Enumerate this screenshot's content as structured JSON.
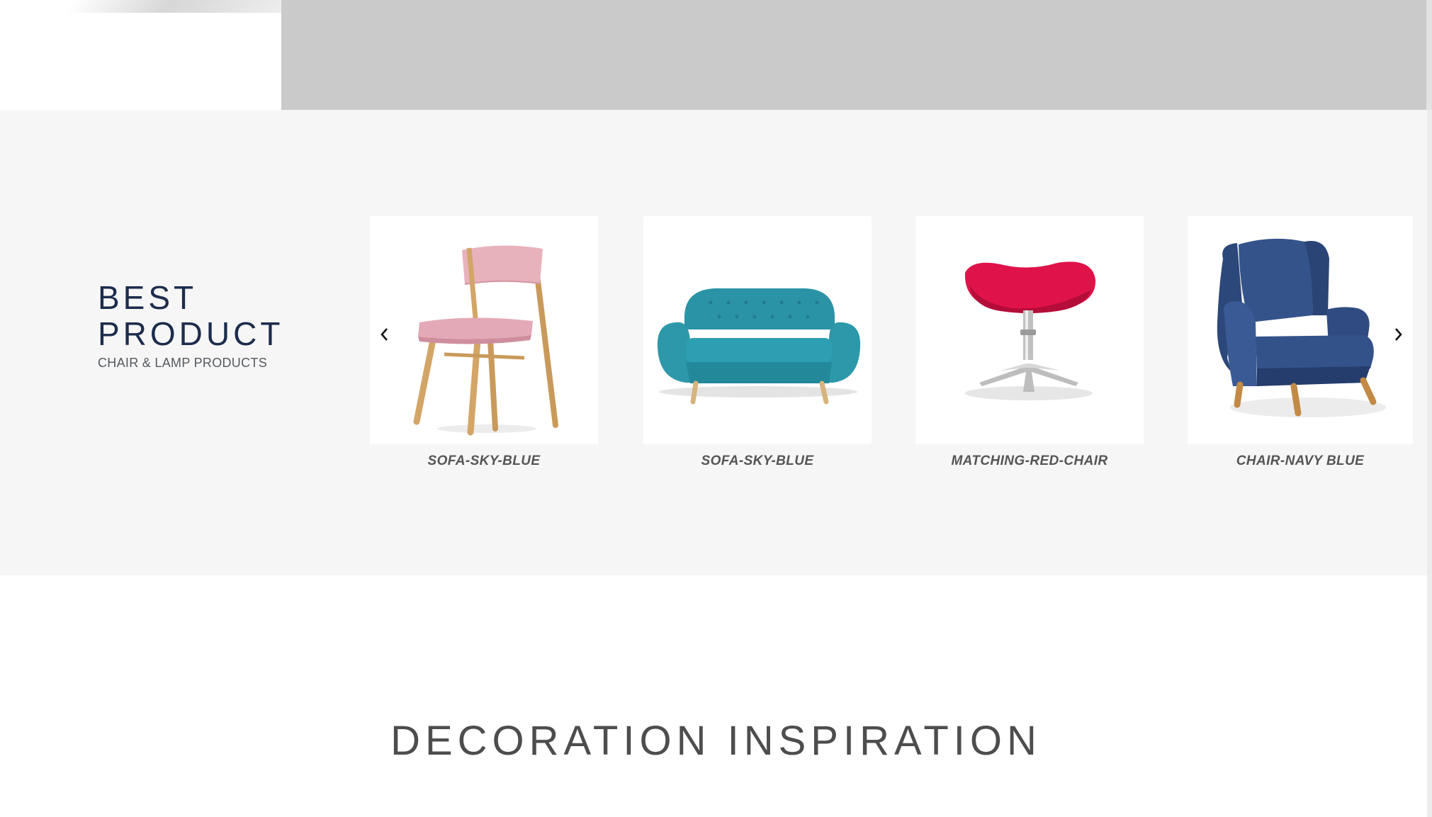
{
  "best_section": {
    "title_line1": "BEST",
    "title_line2": "PRODUCT",
    "subtitle": "CHAIR & LAMP PRODUCTS"
  },
  "carousel": {
    "prev_icon": "chevron-left-icon",
    "next_icon": "chevron-right-icon",
    "products": [
      {
        "name": "SOFA-SKY-BLUE",
        "image": "pink-wooden-chair",
        "color": "#e4a9b6"
      },
      {
        "name": "SOFA-SKY-BLUE",
        "image": "teal-tufted-sofa",
        "color": "#2a93a5"
      },
      {
        "name": "MATCHING-RED-CHAIR",
        "image": "red-swivel-stool",
        "color": "#e0124a"
      },
      {
        "name": "CHAIR-NAVY BLUE",
        "image": "navy-wingback-armchair",
        "color": "#2e4a7e"
      }
    ]
  },
  "decoration": {
    "title": "DECORATION INSPIRATION"
  },
  "colors": {
    "title_navy": "#1c2c4c",
    "section_bg": "#f6f6f6",
    "hero_gray": "#cacaca"
  }
}
